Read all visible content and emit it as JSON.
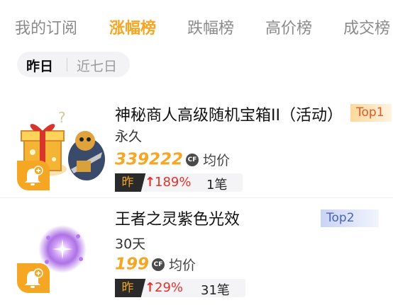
{
  "tabs": [
    "我的订阅",
    "涨幅榜",
    "跌幅榜",
    "高价榜",
    "成交榜"
  ],
  "active_tab": "涨幅榜",
  "period": {
    "selected": "昨日",
    "other": "近七日"
  },
  "items": [
    {
      "name": "神秘商人高级随机宝箱II（活动）",
      "rank": "Top1",
      "duration": "永久",
      "price": "339222",
      "currency_badge": "CF",
      "price_label": "均价",
      "change_tag": "昨",
      "change": "189%",
      "trades": "1笔"
    },
    {
      "name": "王者之灵紫色光效",
      "rank": "Top2",
      "duration": "30天",
      "price": "199",
      "currency_badge": "CF",
      "price_label": "均价",
      "change_tag": "昨",
      "change": "29%",
      "trades": "31笔"
    }
  ],
  "colors": {
    "accent": "#f5a623",
    "up": "#e2312b",
    "top1": "#e2572b",
    "top2": "#4a63b8"
  }
}
